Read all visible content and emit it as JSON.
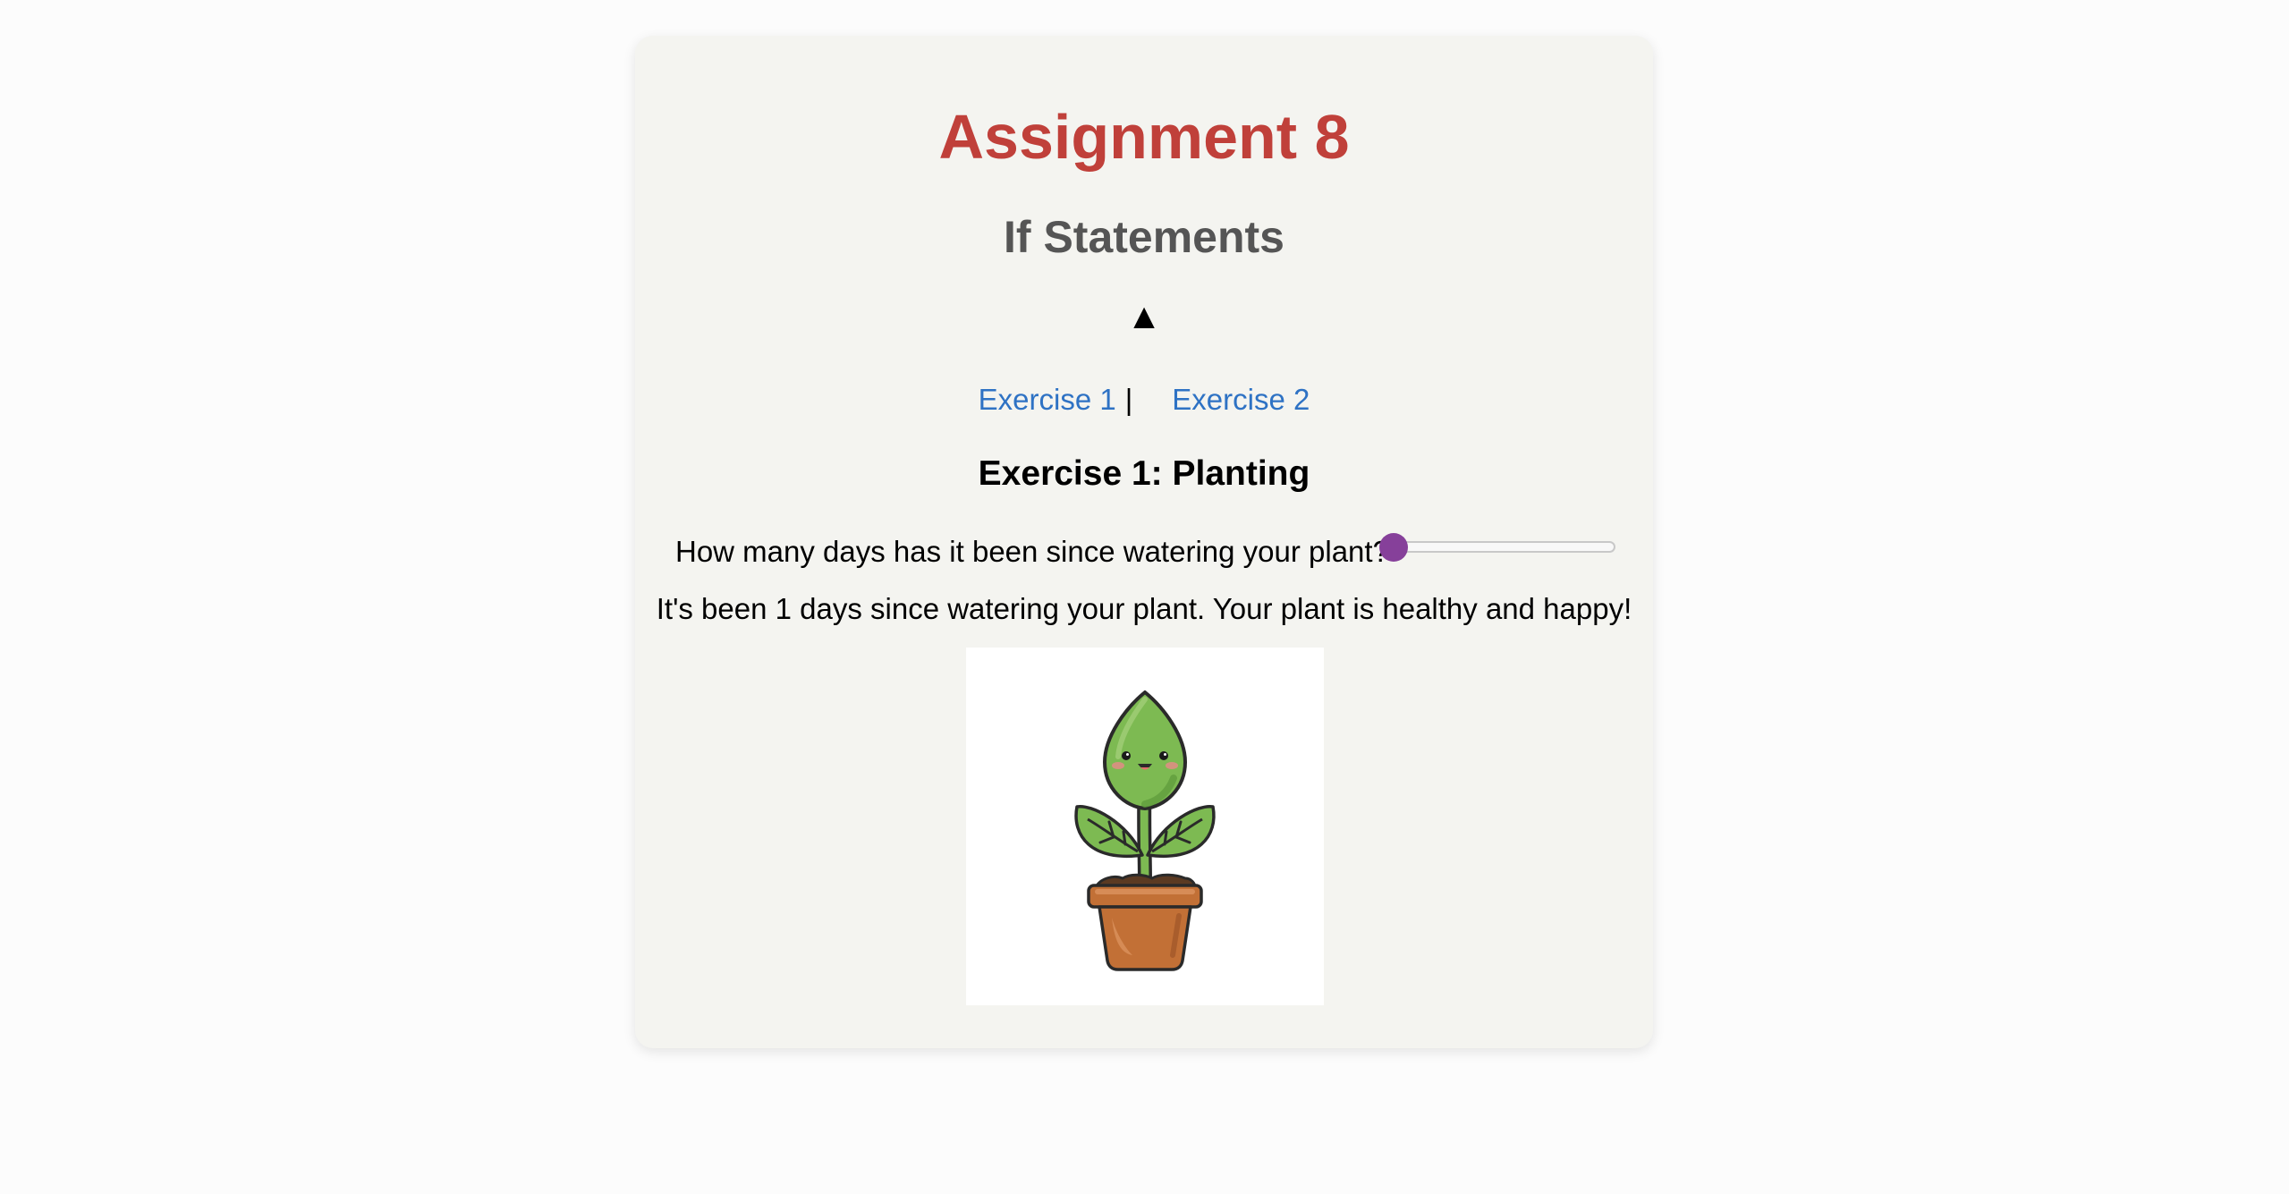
{
  "header": {
    "title": "Assignment 8",
    "subtitle": "If Statements",
    "up_arrow": "▲"
  },
  "nav": {
    "links": [
      {
        "label": "Exercise 1"
      },
      {
        "label": "Exercise 2"
      }
    ],
    "separator": "|"
  },
  "exercise": {
    "heading": "Exercise 1: Planting",
    "question": "How many days has it been since watering your plant?",
    "slider": {
      "value": 1,
      "min": 1,
      "max": 10,
      "thumb_color": "#86409a"
    },
    "result": "It's been 1 days since watering your plant. Your plant is healthy and happy!",
    "image": {
      "icon": "happy-plant-icon",
      "leaf_color": "#7dba52",
      "pot_color": "#c27036"
    }
  },
  "colors": {
    "title": "#c0403a",
    "subtitle": "#555555",
    "link": "#2e72c4",
    "card_background": "#f4f4f0"
  }
}
